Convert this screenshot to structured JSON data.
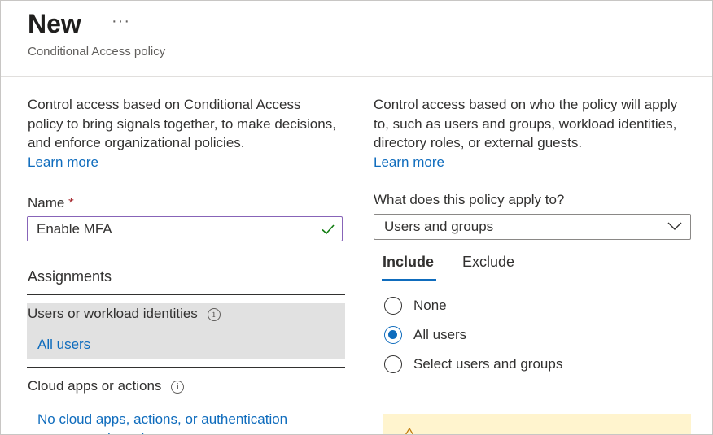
{
  "header": {
    "title": "New",
    "more_label": "···",
    "subtitle": "Conditional Access policy"
  },
  "left": {
    "description": "Control access based on Conditional Access policy to bring signals together, to make decisions, and enforce organizational policies.",
    "learn_more": "Learn more",
    "name_label": "Name",
    "required_mark": "*",
    "name_value": "Enable MFA",
    "assignments_title": "Assignments",
    "users_label": "Users or workload identities",
    "users_value": "All users",
    "cloud_label": "Cloud apps or actions",
    "cloud_value": "No cloud apps, actions, or authentication contexts selected"
  },
  "right": {
    "description": "Control access based on who the policy will apply to, such as users and groups, workload identities, directory roles, or external guests.",
    "learn_more": "Learn more",
    "apply_label": "What does this policy apply to?",
    "apply_value": "Users and groups",
    "tabs": [
      "Include",
      "Exclude"
    ],
    "active_tab": "Include",
    "radios": [
      {
        "label": "None",
        "selected": false
      },
      {
        "label": "All users",
        "selected": true
      },
      {
        "label": "Select users and groups",
        "selected": false
      }
    ]
  },
  "colors": {
    "link": "#0f6cbd",
    "input_focus": "#8764b8",
    "valid_check": "#107c10",
    "required": "#a4262c",
    "selected_row": "#e1e1e1",
    "warning_bg": "#fff4ce"
  },
  "icons": [
    "more-icon",
    "checkmark-icon",
    "info-icon",
    "chevron-down-icon",
    "warning-icon"
  ]
}
